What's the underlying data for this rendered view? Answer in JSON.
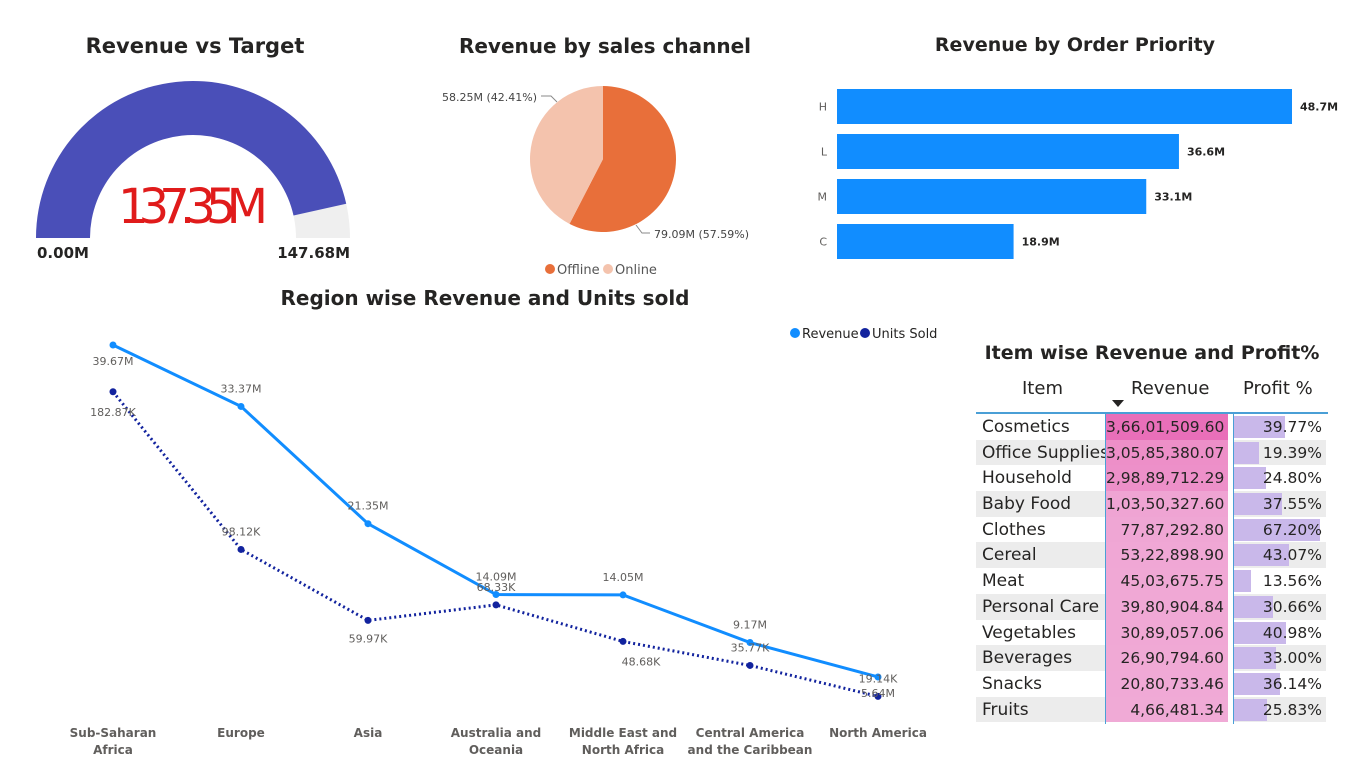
{
  "gauge": {
    "title": "Revenue vs Target",
    "value": 137.35,
    "max": 147.68,
    "value_label": "137.35M",
    "min_label": "0.00M",
    "max_label": "147.68M",
    "fill_color": "#4a4fb8",
    "track_color": "#efefef",
    "value_color": "#e01b1b"
  },
  "chart_data": [
    {
      "type": "pie",
      "title": "Revenue by sales channel",
      "categories": [
        "Offline",
        "Online"
      ],
      "values": [
        79.09,
        58.25
      ],
      "data_labels": [
        "79.09M (57.59%)",
        "58.25M (42.41%)"
      ],
      "colors": [
        "#e86f3a",
        "#f4c3ad"
      ],
      "legend_position": "bottom"
    },
    {
      "type": "bar",
      "orientation": "horizontal",
      "title": "Revenue by Order Priority",
      "categories": [
        "H",
        "L",
        "M",
        "C"
      ],
      "values": [
        48.7,
        36.6,
        33.1,
        18.9
      ],
      "data_labels": [
        "48.7M",
        "36.6M",
        "33.1M",
        "18.9M"
      ],
      "color": "#118dff",
      "xlim": [
        0,
        48.7
      ]
    },
    {
      "type": "line",
      "title": "Region wise Revenue and Units sold",
      "categories": [
        "Sub-Saharan Africa",
        "Europe",
        "Asia",
        "Australia and Oceania",
        "Middle East and North Africa",
        "Central America and the Caribbean",
        "North America"
      ],
      "category_lines": [
        [
          "Sub-Saharan",
          "Africa"
        ],
        [
          "Europe"
        ],
        [
          "Asia"
        ],
        [
          "Australia and",
          "Oceania"
        ],
        [
          "Middle East and",
          "North Africa"
        ],
        [
          "Central America",
          "and the Caribbean"
        ],
        [
          "North America"
        ]
      ],
      "legend_position": "top-right",
      "series": [
        {
          "name": "Revenue",
          "values": [
            39.67,
            33.37,
            21.35,
            14.09,
            14.05,
            9.17,
            5.64
          ],
          "labels": [
            "39.67M",
            "33.37M",
            "21.35M",
            "14.09M",
            "14.05M",
            "9.17M",
            "5.64M"
          ],
          "color": "#118dff",
          "style": "solid"
        },
        {
          "name": "Units Sold",
          "values": [
            182.87,
            98.12,
            59.97,
            68.33,
            48.68,
            35.77,
            19.14
          ],
          "labels": [
            "182.87K",
            "98.12K",
            "59.97K",
            "68.33K",
            "48.68K",
            "35.77K",
            "19.14K"
          ],
          "color": "#12239e",
          "style": "dotted"
        }
      ],
      "revenue_range": [
        0,
        41
      ],
      "units_range": [
        0,
        215
      ]
    }
  ],
  "table": {
    "title": "Item wise Revenue and Profit%",
    "headers": [
      "Item",
      "Revenue",
      "Profit %"
    ],
    "rows": [
      {
        "item": "Cosmetics",
        "revenue": "3,66,01,509.60",
        "revenue_value": 36601509.6,
        "profit": "39.77%",
        "profit_value": 39.77
      },
      {
        "item": "Office Supplies",
        "revenue": "3,05,85,380.07",
        "revenue_value": 30585380.07,
        "profit": "19.39%",
        "profit_value": 19.39
      },
      {
        "item": "Household",
        "revenue": "2,98,89,712.29",
        "revenue_value": 29889712.29,
        "profit": "24.80%",
        "profit_value": 24.8
      },
      {
        "item": "Baby Food",
        "revenue": "1,03,50,327.60",
        "revenue_value": 10350327.6,
        "profit": "37.55%",
        "profit_value": 37.55
      },
      {
        "item": "Clothes",
        "revenue": "77,87,292.80",
        "revenue_value": 7787292.8,
        "profit": "67.20%",
        "profit_value": 67.2
      },
      {
        "item": "Cereal",
        "revenue": "53,22,898.90",
        "revenue_value": 5322898.9,
        "profit": "43.07%",
        "profit_value": 43.07
      },
      {
        "item": "Meat",
        "revenue": "45,03,675.75",
        "revenue_value": 4503675.75,
        "profit": "13.56%",
        "profit_value": 13.56
      },
      {
        "item": "Personal Care",
        "revenue": "39,80,904.84",
        "revenue_value": 3980904.84,
        "profit": "30.66%",
        "profit_value": 30.66
      },
      {
        "item": "Vegetables",
        "revenue": "30,89,057.06",
        "revenue_value": 3089057.06,
        "profit": "40.98%",
        "profit_value": 40.98
      },
      {
        "item": "Beverages",
        "revenue": "26,90,794.60",
        "revenue_value": 2690794.6,
        "profit": "33.00%",
        "profit_value": 33.0
      },
      {
        "item": "Snacks",
        "revenue": "20,80,733.46",
        "revenue_value": 2080733.46,
        "profit": "36.14%",
        "profit_value": 36.14
      },
      {
        "item": "Fruits",
        "revenue": "4,66,481.34",
        "revenue_value": 466481.34,
        "profit": "25.83%",
        "profit_value": 25.83
      }
    ],
    "revenue_colors": [
      "#e96fb9",
      "#f0aad6"
    ],
    "profit_bar_color": "#c9b8ea",
    "profit_max": 67.2
  }
}
